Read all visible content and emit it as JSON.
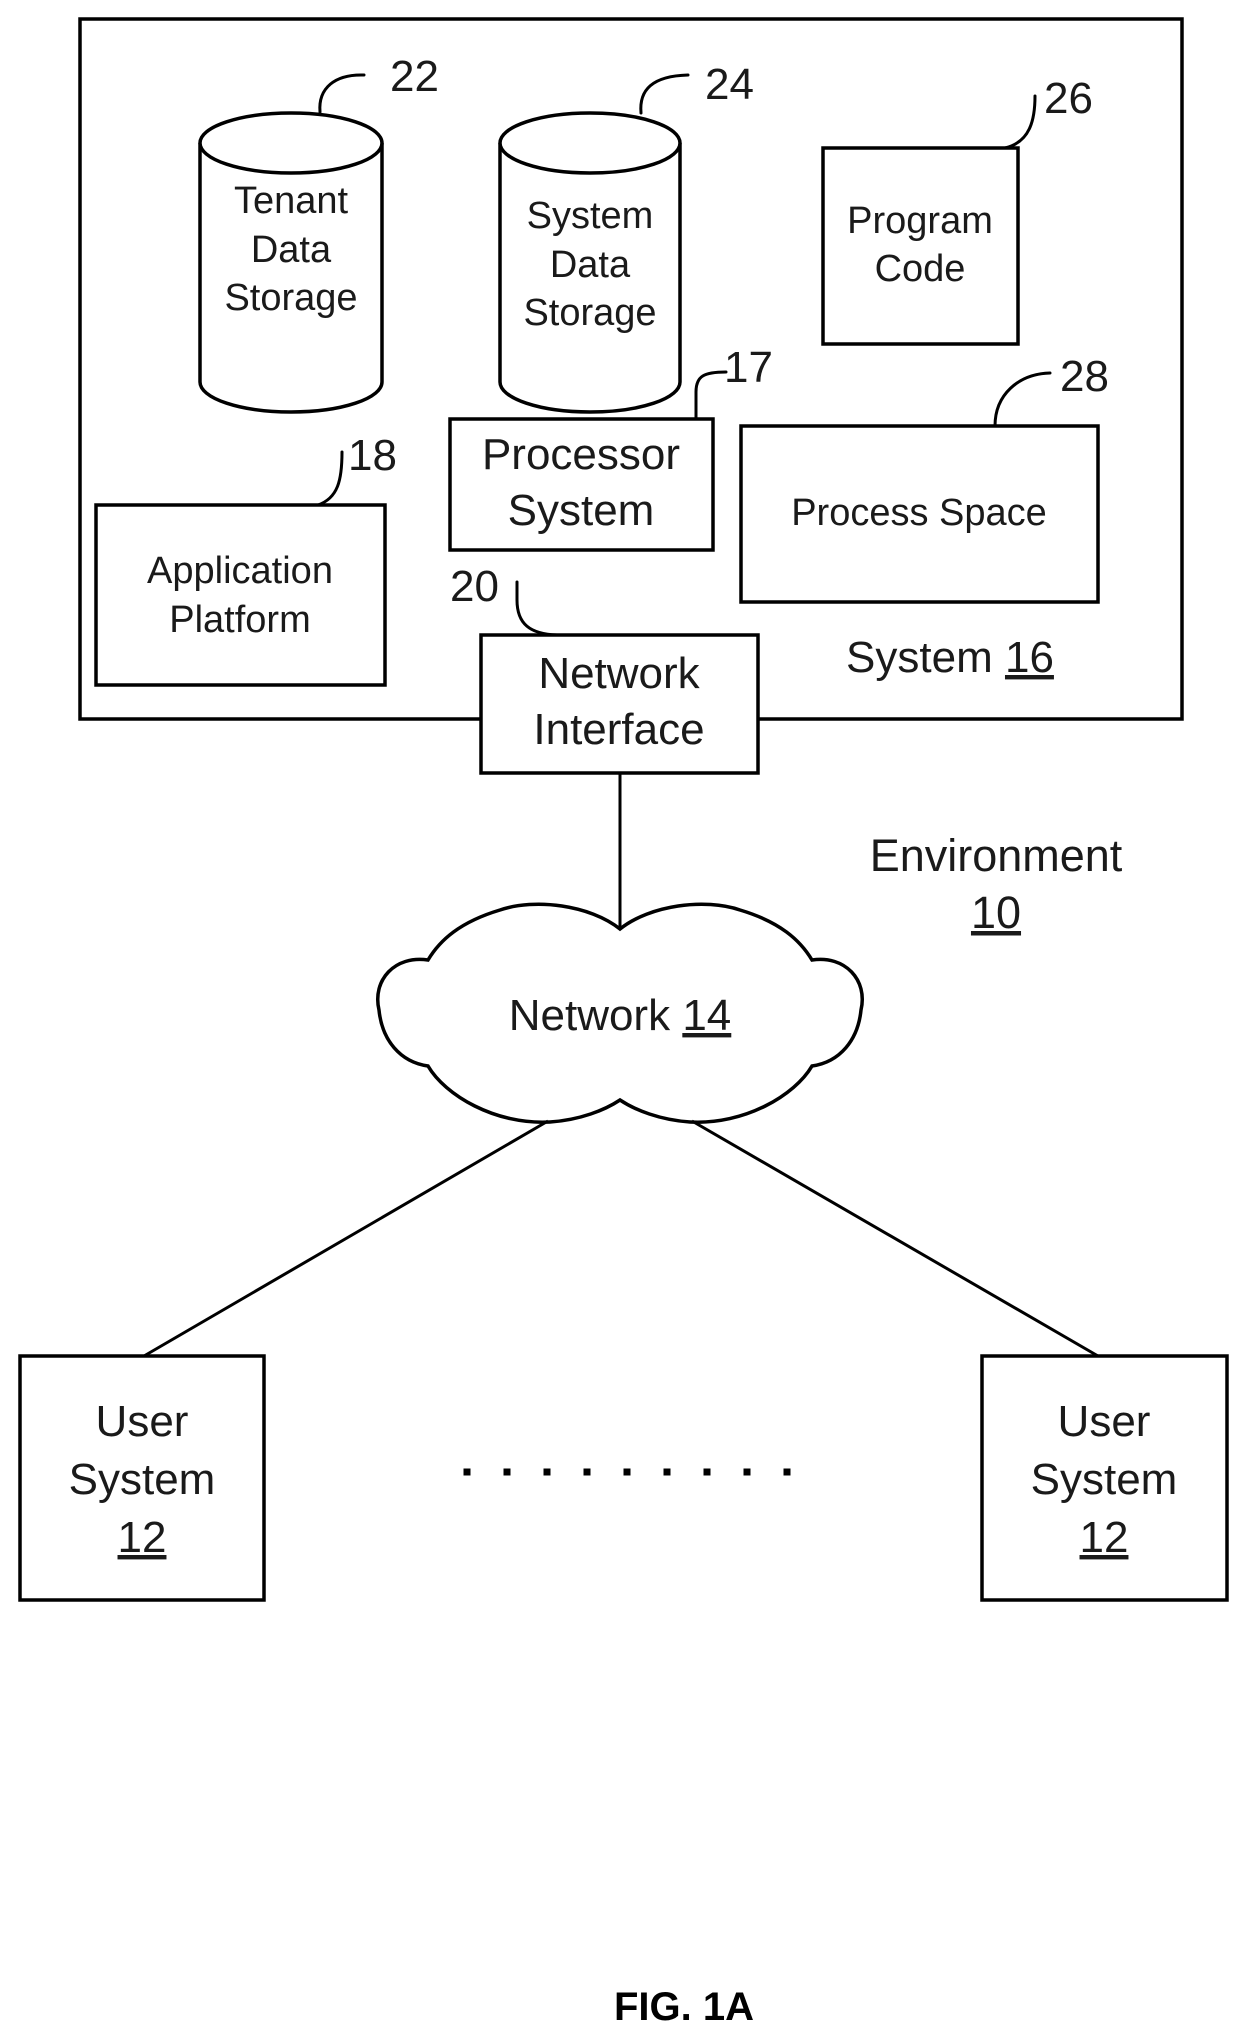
{
  "environment": {
    "label": "Environment",
    "ref": "10"
  },
  "system": {
    "label": "System",
    "ref": "16",
    "components": {
      "tenant_data_storage": {
        "lines": [
          "Tenant",
          "Data",
          "Storage"
        ],
        "ref": "22"
      },
      "system_data_storage": {
        "lines": [
          "System",
          "Data",
          "Storage"
        ],
        "ref": "24"
      },
      "program_code": {
        "lines": [
          "Program",
          "Code"
        ],
        "ref": "26"
      },
      "processor_system": {
        "lines": [
          "Processor",
          "System"
        ],
        "ref": "17"
      },
      "process_space": {
        "lines": [
          "Process Space"
        ],
        "ref": "28"
      },
      "application_platform": {
        "lines": [
          "Application",
          "Platform"
        ],
        "ref": "18"
      },
      "network_interface": {
        "lines": [
          "Network",
          "Interface"
        ],
        "ref": "20"
      }
    }
  },
  "network": {
    "label": "Network",
    "ref": "14"
  },
  "user_systems": [
    {
      "lines": [
        "User",
        "System"
      ],
      "ref": "12"
    },
    {
      "lines": [
        "User",
        "System"
      ],
      "ref": "12"
    }
  ],
  "ellipsis": {
    "dot_count": 9
  },
  "figure_caption": "FIG. 1A"
}
